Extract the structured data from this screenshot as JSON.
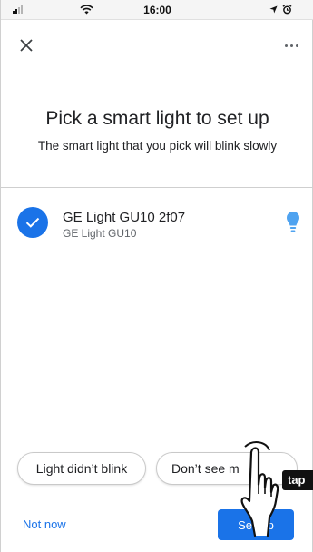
{
  "status_bar": {
    "time": "16:00",
    "icons": [
      "signal-icon",
      "wifi-icon",
      "location-arrow-icon",
      "alarm-icon"
    ]
  },
  "app_bar": {
    "close_icon": "close-icon",
    "more_icon": "more-horizontal-icon"
  },
  "header": {
    "title": "Pick a smart light to set up",
    "subtitle": "The smart light that you pick will blink slowly"
  },
  "device": {
    "name": "GE Light GU10 2f07",
    "type": "GE Light GU10",
    "selected": true,
    "icon": "lightbulb-icon"
  },
  "actions": {
    "light_didnt_blink": "Light didn’t blink",
    "dont_see_my_light": "Don’t see m",
    "not_now": "Not now",
    "set_up": "Set Up"
  },
  "overlay": {
    "tap_label": "tap"
  },
  "colors": {
    "accent": "#1a73e8",
    "bulb": "#4fa3f0"
  }
}
